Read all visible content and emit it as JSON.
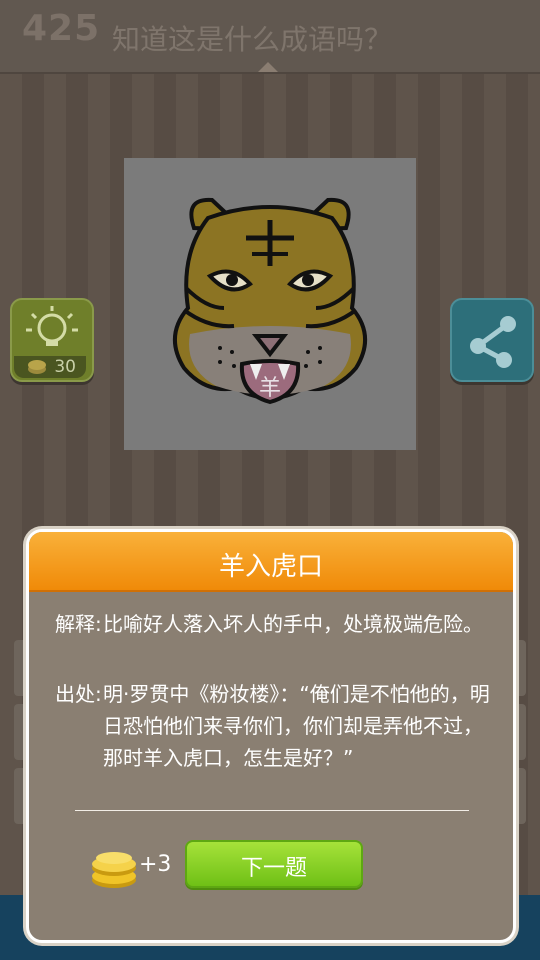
{
  "header": {
    "level": "425",
    "question": "知道这是什么成语吗？"
  },
  "puzzle": {
    "image_icon": "tiger-face-illustration",
    "overlay_char": "羊"
  },
  "hint": {
    "icon": "lightbulb-icon",
    "cost": "30"
  },
  "share": {
    "icon": "share-icon"
  },
  "dialog": {
    "title": "羊入虎口",
    "explanation_label": "解释:",
    "explanation_text": "比喻好人落入坏人的手中，处境极端危险。",
    "source_label": "出处:",
    "source_text": "明·罗贯中《粉妆楼》：“俺们是不怕他的，明日恐怕他们来寻你们，你们却是弄他不过，那时羊入虎口，怎生是好？”",
    "reward": "+3",
    "next_button": "下一题"
  },
  "colors": {
    "header_orange": "#f39a12",
    "next_green": "#8ed62a",
    "bottom_strip": "#16425e"
  }
}
